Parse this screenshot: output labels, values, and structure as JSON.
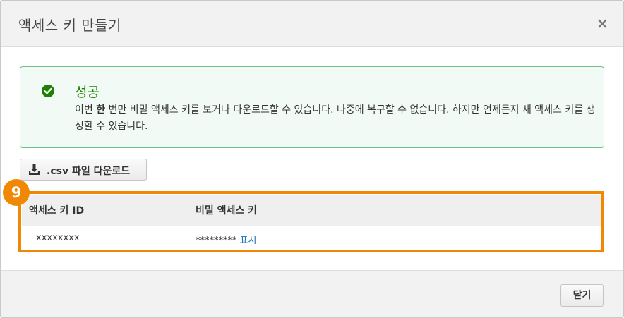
{
  "dialog": {
    "title": "액세스 키 만들기",
    "close_icon": "×"
  },
  "alert": {
    "icon": "check-circle-icon",
    "title": "성공",
    "body_pre": "이번 ",
    "body_bold": "한",
    "body_post": " 번만 비밀 액세스 키를 보거나 다운로드할 수 있습니다. 나중에 복구할 수 없습니다. 하지만 언제든지 새 액세스 키를 생성할 수 있습니다.",
    "color_border": "#6cc28a",
    "color_title": "#1d8102"
  },
  "download": {
    "icon": "download-icon",
    "label": ".csv 파일 다운로드"
  },
  "callout": {
    "number": "9",
    "color": "#f08705"
  },
  "table": {
    "headers": [
      "액세스 키 ID",
      "비밀 액세스 키"
    ],
    "rows": [
      {
        "access_key_id": "xxxxxxxx",
        "secret_masked": "*********",
        "show_link": "표시"
      }
    ]
  },
  "footer": {
    "close_label": "닫기"
  }
}
